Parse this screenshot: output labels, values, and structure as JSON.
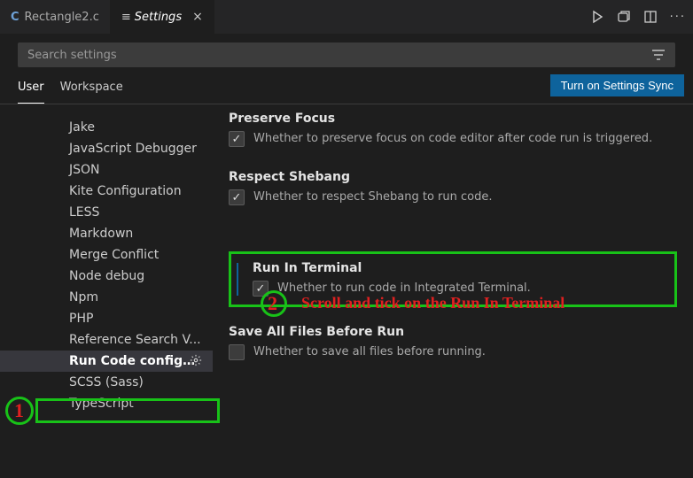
{
  "tabs": [
    {
      "label": "Rectangle2.c",
      "icon": "C",
      "active": false
    },
    {
      "label": "Settings",
      "icon": "settings",
      "active": true
    }
  ],
  "search": {
    "placeholder": "Search settings"
  },
  "scope_tabs": {
    "user": "User",
    "workspace": "Workspace"
  },
  "sync_button": "Turn on Settings Sync",
  "sidebar": {
    "items": [
      "Jake",
      "JavaScript Debugger",
      "JSON",
      "Kite Configuration",
      "LESS",
      "Markdown",
      "Merge Conflict",
      "Node debug",
      "Npm",
      "PHP",
      "Reference Search V...",
      "Run Code configu...",
      "SCSS (Sass)",
      "TypeScript"
    ],
    "selected_index": 11
  },
  "settings": {
    "preserve_focus": {
      "title": "Preserve Focus",
      "desc": "Whether to preserve focus on code editor after code run is triggered.",
      "checked": true
    },
    "respect_shebang": {
      "title": "Respect Shebang",
      "desc": "Whether to respect Shebang to run code.",
      "checked": true
    },
    "run_in_terminal": {
      "title": "Run In Terminal",
      "desc": "Whether to run code in Integrated Terminal.",
      "checked": true
    },
    "save_all": {
      "title": "Save All Files Before Run",
      "desc": "Whether to save all files before running.",
      "checked": false
    }
  },
  "annotations": {
    "one": "1",
    "two": "2",
    "two_text": "Scroll and tick on the Run In Terminal"
  }
}
